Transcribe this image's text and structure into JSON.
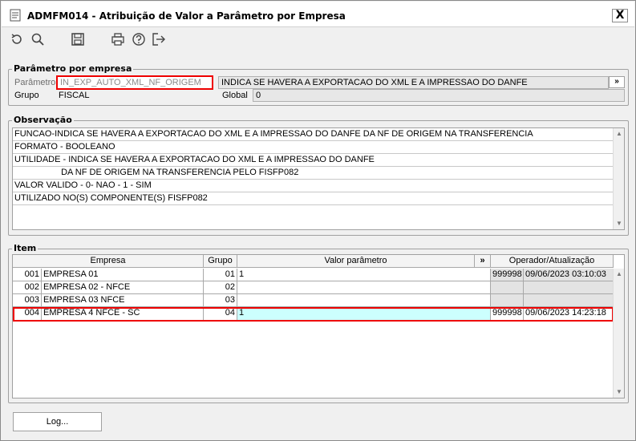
{
  "window": {
    "title": "ADMFM014 - Atribuição de Valor a Parâmetro por Empresa",
    "close_label": "X"
  },
  "toolbar": {
    "buttons": [
      "refresh-icon",
      "search-icon",
      "save-icon",
      "print-icon",
      "help-icon",
      "exit-icon"
    ]
  },
  "parametro_group": {
    "title": "Parâmetro por empresa",
    "parametro_label": "Parâmetro",
    "parametro_value": "IN_EXP_AUTO_XML_NF_ORIGEM",
    "descricao_value": "INDICA SE HAVERA A EXPORTACAO DO XML E A IMPRESSAO DO DANFE",
    "expand_label": "»",
    "grupo_label": "Grupo",
    "grupo_value": "FISCAL",
    "global_label": "Global",
    "global_value": "0"
  },
  "observacao_group": {
    "title": "Observação",
    "lines": [
      "FUNCAO-INDICA SE HAVERA A EXPORTACAO DO XML E A IMPRESSAO DO DANFE DA NF DE ORIGEM NA TRANSFERENCIA",
      "FORMATO - BOOLEANO",
      "UTILIDADE - INDICA SE HAVERA A EXPORTACAO DO XML E A IMPRESSAO DO DANFE",
      "                   DA NF DE ORIGEM NA TRANSFERENCIA PELO FISFP082",
      "VALOR VALIDO - 0- NAO - 1 - SIM",
      "UTILIZADO NO(S) COMPONENTE(S) FISFP082"
    ]
  },
  "item_group": {
    "title": "Item",
    "columns": {
      "empresa": "Empresa",
      "grupo": "Grupo",
      "valor": "Valor parâmetro",
      "expand": "»",
      "operador": "Operador/Atualização"
    },
    "rows": [
      {
        "cod": "001",
        "empresa": "EMPRESA 01",
        "grupo": "01",
        "valor": "1",
        "operador": "999998",
        "atualizacao": "09/06/2023 03:10:03"
      },
      {
        "cod": "002",
        "empresa": "EMPRESA 02 - NFCE",
        "grupo": "02",
        "valor": "",
        "operador": "",
        "atualizacao": ""
      },
      {
        "cod": "003",
        "empresa": "EMPRESA 03 NFCE",
        "grupo": "03",
        "valor": "",
        "operador": "",
        "atualizacao": ""
      },
      {
        "cod": "004",
        "empresa": "EMPRESA 4 NFCE - SC",
        "grupo": "04",
        "valor": "1",
        "operador": "999998",
        "atualizacao": "09/06/2023 14:23:18"
      }
    ]
  },
  "footer": {
    "log_label": "Log..."
  },
  "colors": {
    "highlight_border": "#e00000",
    "selected_cell": "#ccfffe"
  }
}
